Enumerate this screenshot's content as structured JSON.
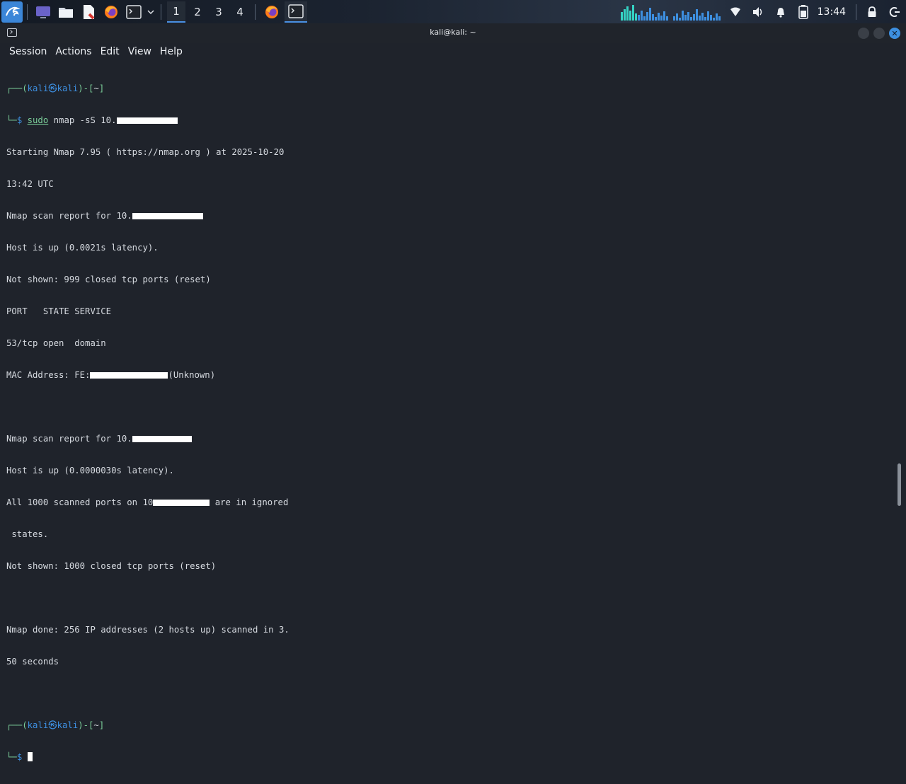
{
  "panel": {
    "workspaces": [
      "1",
      "2",
      "3",
      "4"
    ],
    "active_workspace": "1",
    "clock": "13:44"
  },
  "window": {
    "title": "kali@kali: ~"
  },
  "menu": [
    "Session",
    "Actions",
    "Edit",
    "View",
    "Help"
  ],
  "terminal": {
    "prompt1": {
      "top": "┌──(",
      "user": "kali",
      "at": "㉿",
      "host": "kali",
      "mid": ")-[",
      "dir": "~",
      "end": "]",
      "bottom": "└─",
      "dollar": "$ ",
      "cmd_sudo": "sudo",
      "cmd_rest": " nmap -sS 10."
    },
    "lines": {
      "l1": "Starting Nmap 7.95 ( https://nmap.org ) at 2025-10-20",
      "l2": "13:42 UTC",
      "l3": "Nmap scan report for 10.",
      "l4": "Host is up (0.0021s latency).",
      "l5": "Not shown: 999 closed tcp ports (reset)",
      "l6": "PORT   STATE SERVICE",
      "l7": "53/tcp open  domain",
      "l8a": "MAC Address: FE:",
      "l8b": "(Unknown)",
      "l9": "Nmap scan report for 10.",
      "l10": "Host is up (0.0000030s latency).",
      "l11a": "All 1000 scanned ports on 10",
      "l11b": " are in ignored",
      "l12": " states.",
      "l13": "Not shown: 1000 closed tcp ports (reset)",
      "l14": "Nmap done: 256 IP addresses (2 hosts up) scanned in 3.",
      "l15": "50 seconds"
    }
  }
}
